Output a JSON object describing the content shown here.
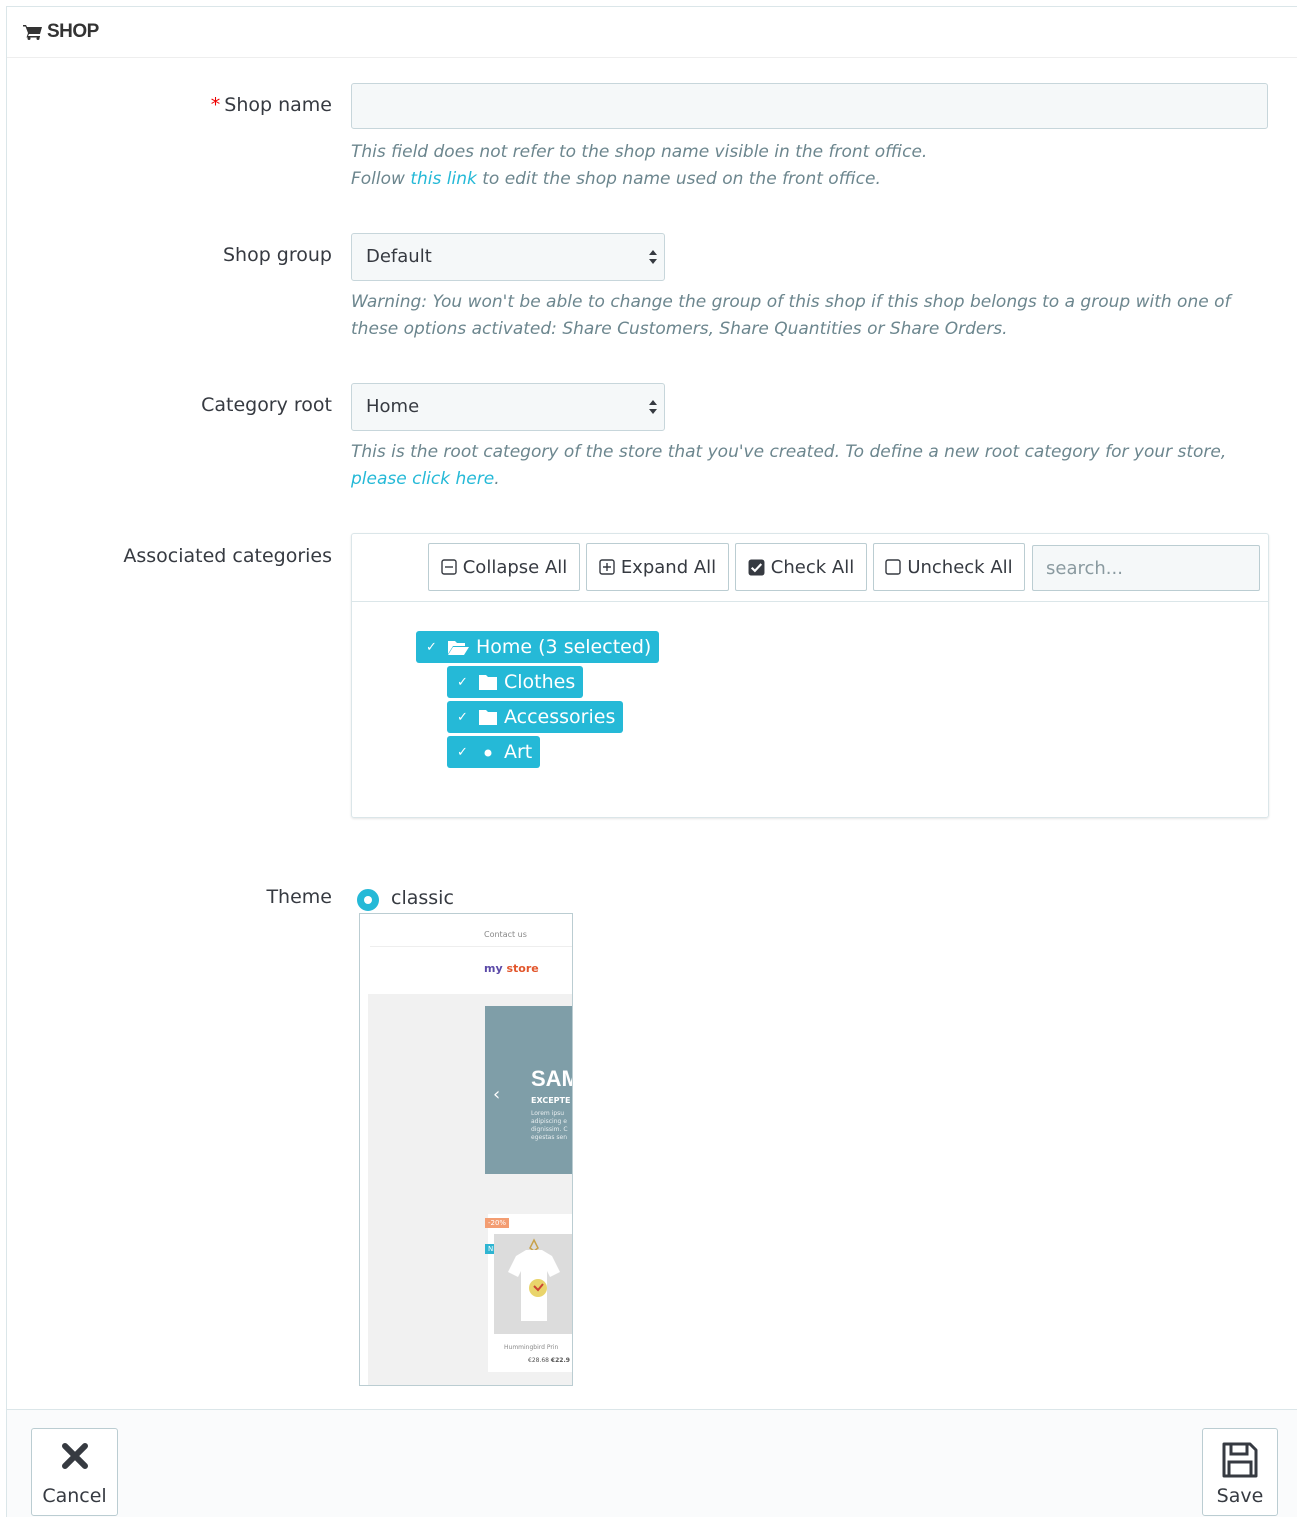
{
  "header": {
    "title": "SHOP"
  },
  "fields": {
    "shop_name": {
      "required_mark": "*",
      "label": "Shop name",
      "value": "",
      "help_line1": "This field does not refer to the shop name visible in the front office.",
      "help_line2_prefix": "Follow ",
      "help_line2_link": "this link",
      "help_line2_suffix": " to edit the shop name used on the front office."
    },
    "shop_group": {
      "label": "Shop group",
      "selected": "Default",
      "help": "Warning: You won't be able to change the group of this shop if this shop belongs to a group with one of these options activated: Share Customers, Share Quantities or Share Orders."
    },
    "category_root": {
      "label": "Category root",
      "selected": "Home",
      "help_prefix": "This is the root category of the store that you've created. To define a new root category for your store, ",
      "help_link": "please click here",
      "help_suffix": "."
    },
    "associated_categories": {
      "label": "Associated categories",
      "toolbar": {
        "collapse": "Collapse All",
        "expand": "Expand All",
        "check": "Check All",
        "uncheck": "Uncheck All",
        "search_placeholder": "search..."
      },
      "tree": [
        {
          "label": "Home (3 selected)",
          "checked": true,
          "icon": "folder-open-icon"
        },
        {
          "label": "Clothes",
          "checked": true,
          "icon": "folder-icon"
        },
        {
          "label": "Accessories",
          "checked": true,
          "icon": "folder-icon"
        },
        {
          "label": "Art",
          "checked": true,
          "icon": "bullet-icon"
        }
      ]
    },
    "theme": {
      "label": "Theme",
      "option": "classic",
      "preview": {
        "contact": "Contact us",
        "logo_my": "my",
        "logo_store": "store",
        "slide_title": "SAM",
        "slide_sub": "EXCEPTE",
        "slide_text": [
          "Lorem ipsu",
          "adipiscing e",
          "dignissim. C",
          "egestas sen"
        ],
        "badge_discount": "-20%",
        "badge_new": "NEW",
        "product_name": "Hummingbird Prin",
        "price_old": "€28.68",
        "price_new": "€22.9"
      }
    }
  },
  "footer": {
    "cancel": "Cancel",
    "save": "Save"
  },
  "colors": {
    "accent": "#25b9d7",
    "required": "#ee0000",
    "help": "#6c868e"
  }
}
